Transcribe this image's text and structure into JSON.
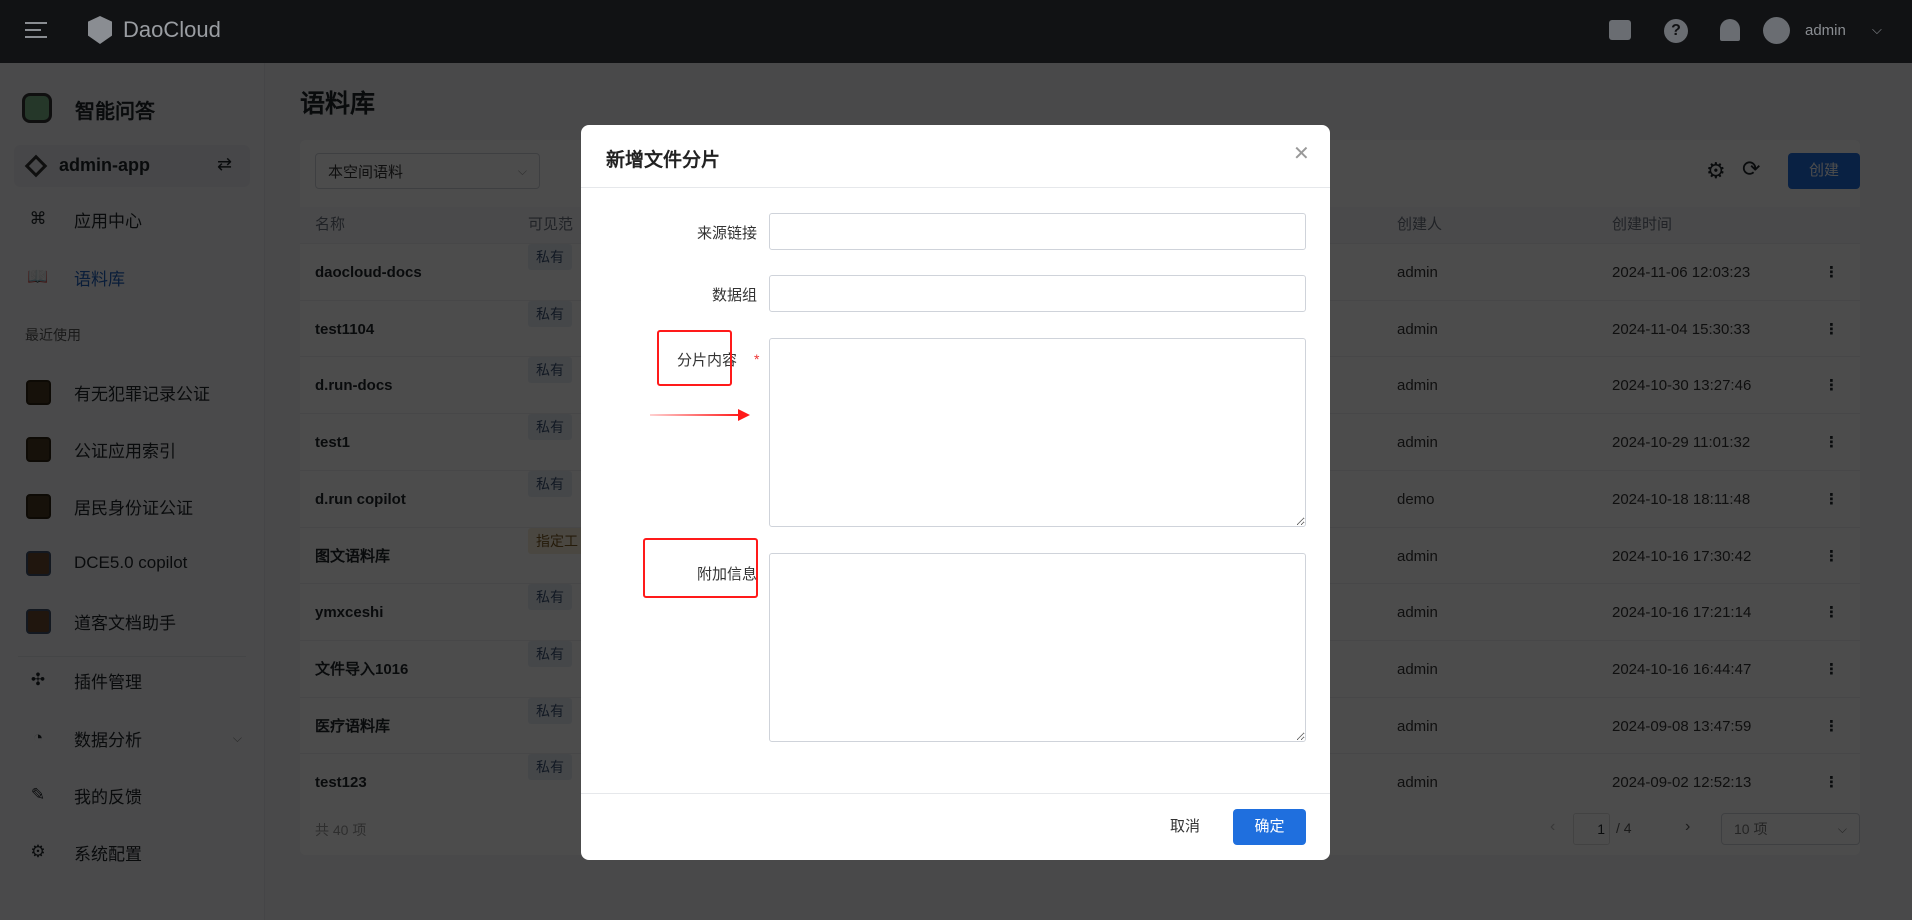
{
  "header": {
    "brand": "DaoCloud",
    "user": "admin"
  },
  "sidebar": {
    "app_title": "智能问答",
    "current_app": "admin-app",
    "nav": [
      {
        "label": "应用中心"
      },
      {
        "label": "语料库"
      }
    ],
    "recent_title": "最近使用",
    "recent": [
      {
        "label": "有无犯罪记录公证"
      },
      {
        "label": "公证应用索引"
      },
      {
        "label": "居民身份证公证"
      },
      {
        "label": "DCE5.0 copilot"
      },
      {
        "label": "道客文档助手"
      }
    ],
    "bottom": [
      {
        "label": "插件管理"
      },
      {
        "label": "数据分析"
      },
      {
        "label": "我的反馈"
      },
      {
        "label": "系统配置"
      }
    ]
  },
  "main": {
    "title": "语料库",
    "filter": "本空间语料",
    "create_label": "创建",
    "columns": [
      "名称",
      "可见范",
      "创建人",
      "创建时间"
    ],
    "rows": [
      {
        "name": "daocloud-docs",
        "scope": "私有",
        "creator": "admin",
        "time": "2024-11-06 12:03:23"
      },
      {
        "name": "test1104",
        "scope": "私有",
        "creator": "admin",
        "time": "2024-11-04 15:30:33"
      },
      {
        "name": "d.run-docs",
        "scope": "私有",
        "creator": "admin",
        "time": "2024-10-30 13:27:46"
      },
      {
        "name": "test1",
        "scope": "私有",
        "creator": "admin",
        "time": "2024-10-29 11:01:32"
      },
      {
        "name": "d.run copilot",
        "scope": "私有",
        "creator": "demo",
        "time": "2024-10-18 18:11:48"
      },
      {
        "name": "图文语料库",
        "scope": "指定工",
        "creator": "admin",
        "time": "2024-10-16 17:30:42"
      },
      {
        "name": "ymxceshi",
        "scope": "私有",
        "creator": "admin",
        "time": "2024-10-16 17:21:14"
      },
      {
        "name": "文件导入1016",
        "scope": "私有",
        "creator": "admin",
        "time": "2024-10-16 16:44:47"
      },
      {
        "name": "医疗语料库",
        "scope": "私有",
        "creator": "admin",
        "time": "2024-09-08 13:47:59"
      },
      {
        "name": "test123",
        "scope": "私有",
        "creator": "admin",
        "time": "2024-09-02 12:52:13"
      }
    ],
    "total": "共 40 项",
    "page": "1",
    "page_total": "/ 4",
    "page_size": "10 项"
  },
  "modal": {
    "title": "新增文件分片",
    "fields": [
      {
        "label": "来源链接",
        "value": ""
      },
      {
        "label": "数据组",
        "value": ""
      },
      {
        "label": "分片内容",
        "required": "*",
        "value": ""
      },
      {
        "label": "附加信息",
        "value": ""
      }
    ],
    "cancel": "取消",
    "confirm": "确定"
  },
  "colors": {
    "primary": "#1f6fde",
    "annotation": "#ff1a1a"
  }
}
